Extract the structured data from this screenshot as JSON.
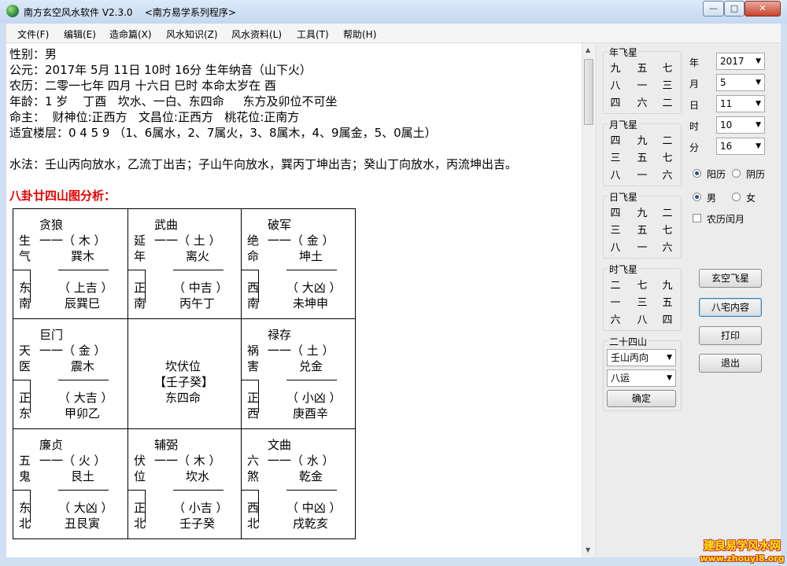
{
  "window": {
    "title": "南方玄空风水软件 V2.3.0    <南方易学系列程序>",
    "min_label": "—",
    "max_label": "□",
    "close_label": "✕"
  },
  "menu": [
    "文件(F)",
    "编辑(E)",
    "造命篇(X)",
    "风水知识(Z)",
    "风水资料(L)",
    "工具(T)",
    "帮助(H)"
  ],
  "content": {
    "lines": [
      "性别：男",
      "公元：2017年 5月 11日 10时 16分 生年纳音（山下火）",
      "农历：二零一七年 四月 十六日 巳时 本命太岁在 酉",
      "年龄：1 岁    丁酉   坎水、一白、东四命     东方及卯位不可坐",
      "命主：  财神位:正西方   文昌位:正西方   桃花位:正南方",
      "适宜楼层：0 4 5 9 （1、6属水，2、7属火，3、8属木，4、9属金，5、0属土）",
      "水法：壬山丙向放水，乙流丁出吉；子山午向放水，巽丙丁坤出吉；癸山丁向放水，丙流坤出吉。"
    ],
    "section_title": "八卦廿四山图分析：",
    "grid": {
      "cells": [
        {
          "star": "贪狼",
          "side1": "生",
          "side2": "气",
          "elem": "一一（ 木 ）",
          "gua": "巽木",
          "dir1": "东",
          "dir2": "南",
          "luck": "（ 上吉 ）",
          "mountains": "辰巽巳"
        },
        {
          "star": "武曲",
          "side1": "延",
          "side2": "年",
          "elem": "一一（ 土 ）",
          "gua": "离火",
          "dir1": "正",
          "dir2": "南",
          "luck": "（ 中吉 ）",
          "mountains": "丙午丁"
        },
        {
          "star": "破军",
          "side1": "绝",
          "side2": "命",
          "elem": "一一（ 金 ）",
          "gua": "坤土",
          "dir1": "西",
          "dir2": "南",
          "luck": "（ 大凶 ）",
          "mountains": "未坤申"
        },
        {
          "star": "巨门",
          "side1": "天",
          "side2": "医",
          "elem": "一一（ 金 ）",
          "gua": "震木",
          "dir1": "正",
          "dir2": "东",
          "luck": "（ 大吉 ）",
          "mountains": "甲卯乙"
        },
        {
          "star": "禄存",
          "side1": "祸",
          "side2": "害",
          "elem": "一一（ 土 ）",
          "gua": "兑金",
          "dir1": "正",
          "dir2": "西",
          "luck": "（ 小凶 ）",
          "mountains": "庚酉辛"
        },
        {
          "star": "廉贞",
          "side1": "五",
          "side2": "鬼",
          "elem": "一一（ 火 ）",
          "gua": "艮土",
          "dir1": "东",
          "dir2": "北",
          "luck": "（ 大凶 ）",
          "mountains": "丑艮寅"
        },
        {
          "star": "辅弼",
          "side1": "伏",
          "side2": "位",
          "elem": "一一（ 木 ）",
          "gua": "坎水",
          "dir1": "正",
          "dir2": "北",
          "luck": "（ 小吉 ）",
          "mountains": "壬子癸"
        },
        {
          "star": "文曲",
          "side1": "六",
          "side2": "煞",
          "elem": "一一（ 水 ）",
          "gua": "乾金",
          "dir1": "西",
          "dir2": "北",
          "luck": "（ 中凶 ）",
          "mountains": "戌乾亥"
        }
      ],
      "center": {
        "line1": "坎伏位",
        "line2": "【壬子癸】",
        "line3": "东四命"
      }
    }
  },
  "panel": {
    "year_star": {
      "title": "年飞星",
      "rows": [
        [
          "九",
          "五",
          "七"
        ],
        [
          "八",
          "一",
          "三"
        ],
        [
          "四",
          "六",
          "二"
        ]
      ]
    },
    "month_star": {
      "title": "月飞星",
      "rows": [
        [
          "四",
          "九",
          "二"
        ],
        [
          "三",
          "五",
          "七"
        ],
        [
          "八",
          "一",
          "六"
        ]
      ]
    },
    "day_star": {
      "title": "日飞星",
      "rows": [
        [
          "四",
          "九",
          "二"
        ],
        [
          "三",
          "五",
          "七"
        ],
        [
          "八",
          "一",
          "六"
        ]
      ]
    },
    "hour_star": {
      "title": "时飞星",
      "rows": [
        [
          "二",
          "七",
          "九"
        ],
        [
          "一",
          "三",
          "五"
        ],
        [
          "六",
          "八",
          "四"
        ]
      ]
    },
    "date": {
      "year_label": "年",
      "year_value": "2017",
      "month_label": "月",
      "month_value": "5",
      "day_label": "日",
      "day_value": "11",
      "hour_label": "时",
      "hour_value": "10",
      "minute_label": "分",
      "minute_value": "16"
    },
    "calendar": {
      "solar_label": "阳历",
      "lunar_label": "阴历",
      "selected": "阳历"
    },
    "gender": {
      "male_label": "男",
      "female_label": "女",
      "selected": "男"
    },
    "leap_label": "农历闰月",
    "mountains": {
      "title": "二十四山",
      "direction_value": "壬山丙向",
      "period_value": "八运",
      "ok_label": "确定"
    },
    "buttons": {
      "xuankong": "玄空飞星",
      "bazhai": "八宅内容",
      "print": "打印",
      "exit": "退出"
    }
  },
  "watermark": {
    "line1": "建良易学风水网",
    "line2": "www.zhouyi8.org"
  }
}
